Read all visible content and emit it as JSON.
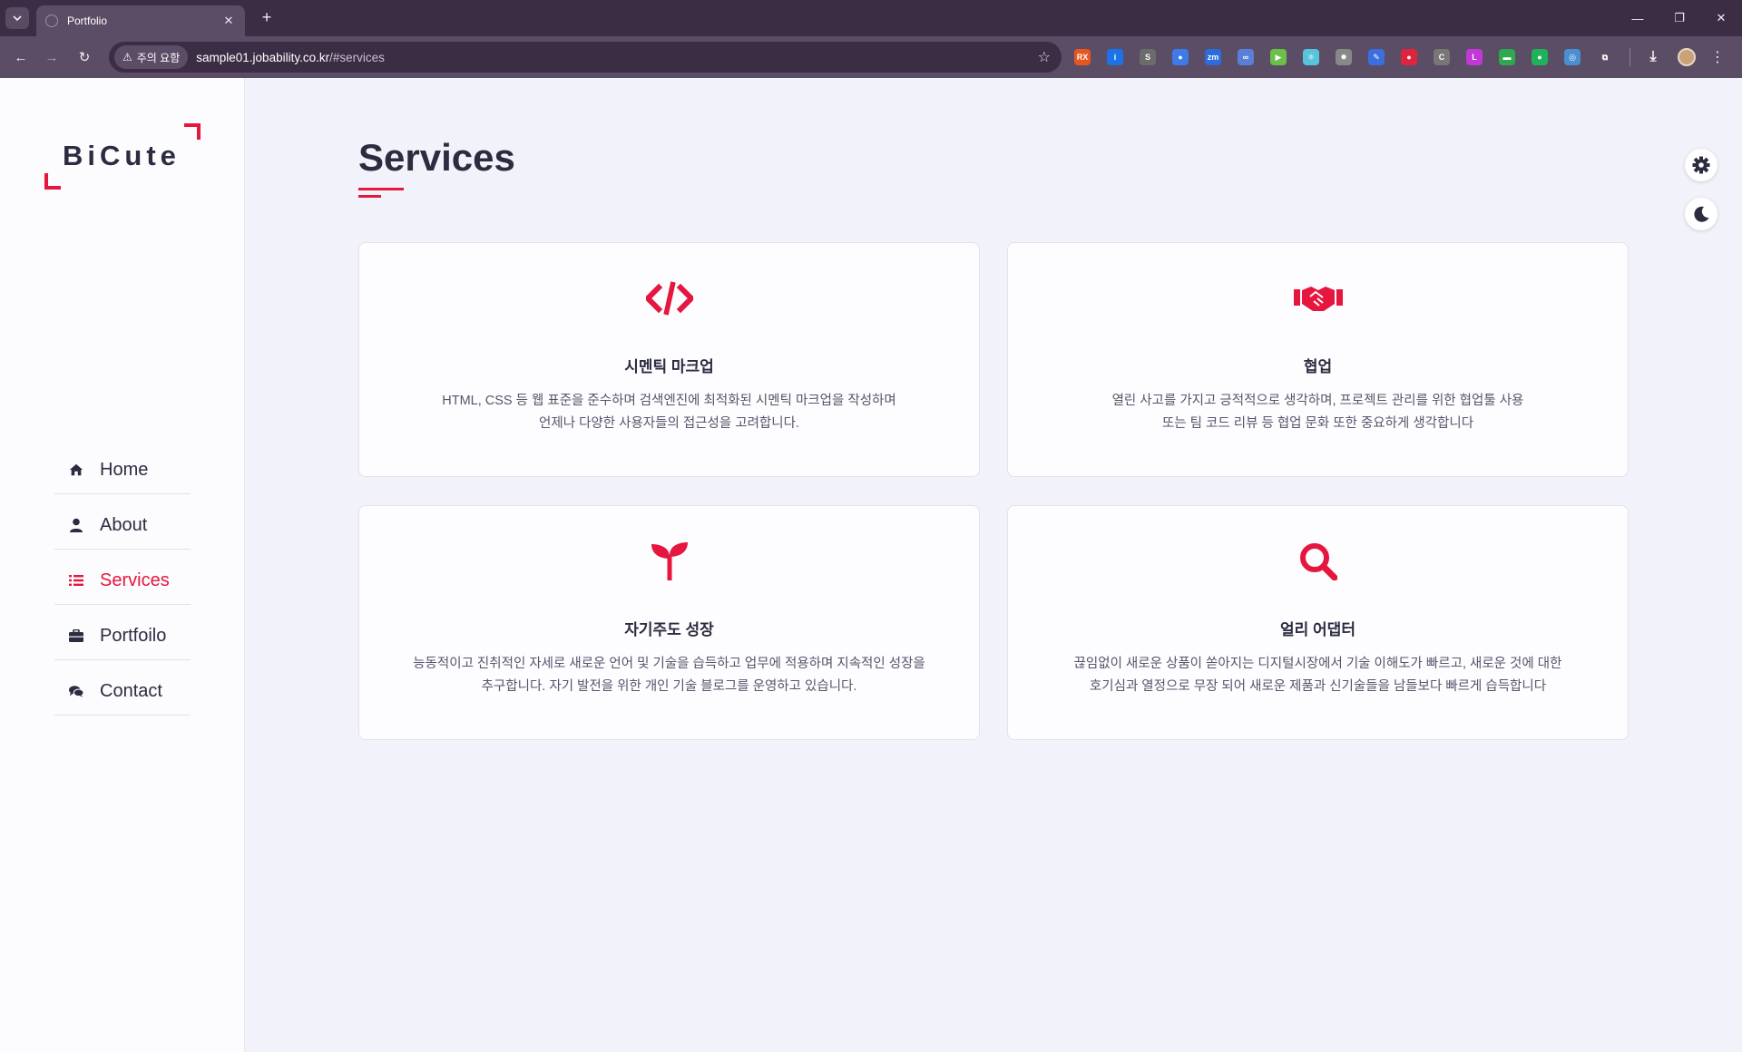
{
  "browser": {
    "tab": {
      "title": "Portfolio",
      "close_glyph": "✕"
    },
    "new_tab_glyph": "+",
    "window_controls": {
      "minimize": "—",
      "restore": "❐",
      "close": "✕"
    },
    "nav": {
      "back": "←",
      "forward": "→",
      "reload": "↻"
    },
    "omnibox": {
      "security_label": "주의 요함",
      "warning_glyph": "⚠",
      "url_host": "sample01.jobability.co.kr",
      "url_path": "/#services"
    },
    "bookmark_glyph": "☆",
    "menu_glyph": "⋮",
    "extensions": [
      {
        "name": "ext-rx-icon",
        "label": "RX",
        "color": "#e8561f"
      },
      {
        "name": "ext-info-icon",
        "label": "i",
        "color": "#1a73e8"
      },
      {
        "name": "ext-s-icon",
        "label": "S",
        "color": "#6b6b6b"
      },
      {
        "name": "ext-droplet-icon",
        "label": "●",
        "color": "#3c7be8"
      },
      {
        "name": "ext-zm-icon",
        "label": "zm",
        "color": "#2d6cdf"
      },
      {
        "name": "ext-link-icon",
        "label": "∞",
        "color": "#5a7fd6"
      },
      {
        "name": "ext-play-icon",
        "label": "▶",
        "color": "#6cc04a"
      },
      {
        "name": "ext-react-icon",
        "label": "⚛",
        "color": "#58c4dc"
      },
      {
        "name": "ext-gear-icon",
        "label": "✹",
        "color": "#888888"
      },
      {
        "name": "ext-pen-icon",
        "label": "✎",
        "color": "#3b6fe0"
      },
      {
        "name": "ext-record-icon",
        "label": "●",
        "color": "#e0243d"
      },
      {
        "name": "ext-ci-icon",
        "label": "C",
        "color": "#777777"
      },
      {
        "name": "ext-lo-icon",
        "label": "L",
        "color": "#c238d6"
      },
      {
        "name": "ext-card-icon",
        "label": "▬",
        "color": "#2fa84f"
      },
      {
        "name": "ext-chat-icon",
        "label": "●",
        "color": "#20b25a"
      },
      {
        "name": "ext-globe-icon",
        "label": "◎",
        "color": "#4a8fcf"
      },
      {
        "name": "extensions-puzzle-icon",
        "label": "⧉",
        "color": "#5c4d66"
      }
    ],
    "download_glyph": "⤓"
  },
  "sidebar": {
    "logo_text": "BiCute",
    "nav_items": [
      {
        "label": "Home",
        "icon": "home-icon",
        "active": false
      },
      {
        "label": "About",
        "icon": "user-icon",
        "active": false
      },
      {
        "label": "Services",
        "icon": "list-icon",
        "active": true
      },
      {
        "label": "Portfoilo",
        "icon": "briefcase-icon",
        "active": false
      },
      {
        "label": "Contact",
        "icon": "comments-icon",
        "active": false
      }
    ]
  },
  "main": {
    "section_title": "Services",
    "services": [
      {
        "icon": "code-icon",
        "title": "시멘틱 마크업",
        "desc_line1": "HTML, CSS 등 웹 표준을 준수하며 검색엔진에 최적화된 시멘틱 마크업을 작성하며",
        "desc_line2": "언제나 다양한 사용자들의 접근성을 고려합니다."
      },
      {
        "icon": "handshake-icon",
        "title": "협업",
        "desc_line1": "열린 사고를 가지고 긍적적으로 생각하며, 프로젝트 관리를 위한 협업툴 사용",
        "desc_line2": "또는 팀 코드 리뷰 등 협업 문화 또한 중요하게 생각합니다"
      },
      {
        "icon": "seedling-icon",
        "title": "자기주도 성장",
        "desc_line1": "능동적이고 진취적인 자세로 새로운 언어 및 기술을 습득하고 업무에 적용하며 지속적인 성장을",
        "desc_line2": "추구합니다. 자기 발전을 위한 개인 기술 블로그를 운영하고 있습니다."
      },
      {
        "icon": "search-icon",
        "title": "얼리 어댑터",
        "desc_line1": "끊임없이 새로운 상품이 쏟아지는 디지털시장에서 기술 이해도가 빠르고, 새로운 것에 대한",
        "desc_line2": "호기심과 열정으로 무장 되어 새로운 제품과 신기술들을 남들보다 빠르게 습득합니다"
      }
    ]
  },
  "theme": {
    "accent": "#e5173f",
    "text": "#2b2c40",
    "page_bg": "#f2f3fa"
  }
}
